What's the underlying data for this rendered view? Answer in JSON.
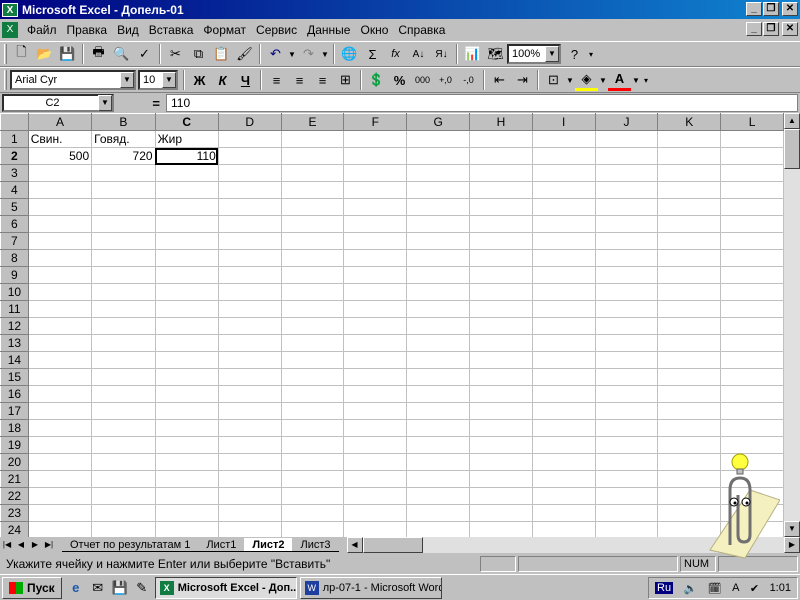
{
  "window": {
    "title": "Microsoft Excel - Допель-01",
    "minimize": "_",
    "restore": "❐",
    "close": "✕"
  },
  "menu": [
    "Файл",
    "Правка",
    "Вид",
    "Вставка",
    "Формат",
    "Сервис",
    "Данные",
    "Окно",
    "Справка"
  ],
  "toolbar": {
    "zoom": "100%",
    "font_name": "Arial Cyr",
    "font_size": "10",
    "bold": "Ж",
    "italic": "К",
    "underline": "Ч",
    "percent": "%",
    "thousands": "000",
    "sum": "Σ",
    "fx": "fx"
  },
  "formula_bar": {
    "name_box": "C2",
    "equals": "=",
    "value": "110"
  },
  "grid": {
    "columns": [
      "A",
      "B",
      "C",
      "D",
      "E",
      "F",
      "G",
      "H",
      "I",
      "J",
      "K",
      "L"
    ],
    "rows": [
      [
        "Свин.",
        "Говяд.",
        "Жир",
        "",
        "",
        "",
        "",
        "",
        "",
        "",
        "",
        ""
      ],
      [
        "500",
        "720",
        "110",
        "",
        "",
        "",
        "",
        "",
        "",
        "",
        "",
        ""
      ]
    ],
    "row_count": 24,
    "active_column": "C",
    "active_row": 2
  },
  "sheets": {
    "tabs": [
      "Отчет по результатам 1",
      "Лист1",
      "Лист2",
      "Лист3"
    ],
    "active": "Лист2"
  },
  "status": {
    "message": "Укажите ячейку и нажмите Enter или выберите \"Вставить\"",
    "num": "NUM"
  },
  "taskbar": {
    "start": "Пуск",
    "tasks": [
      "Microsoft Excel - Доп...",
      "лр-07-1 - Microsoft Word"
    ],
    "lang": "Ru",
    "clock": "1:01"
  },
  "colors": {
    "title_start": "#000080",
    "title_end": "#1084d0",
    "face": "#c0c0c0",
    "excel_green": "#107c41"
  }
}
